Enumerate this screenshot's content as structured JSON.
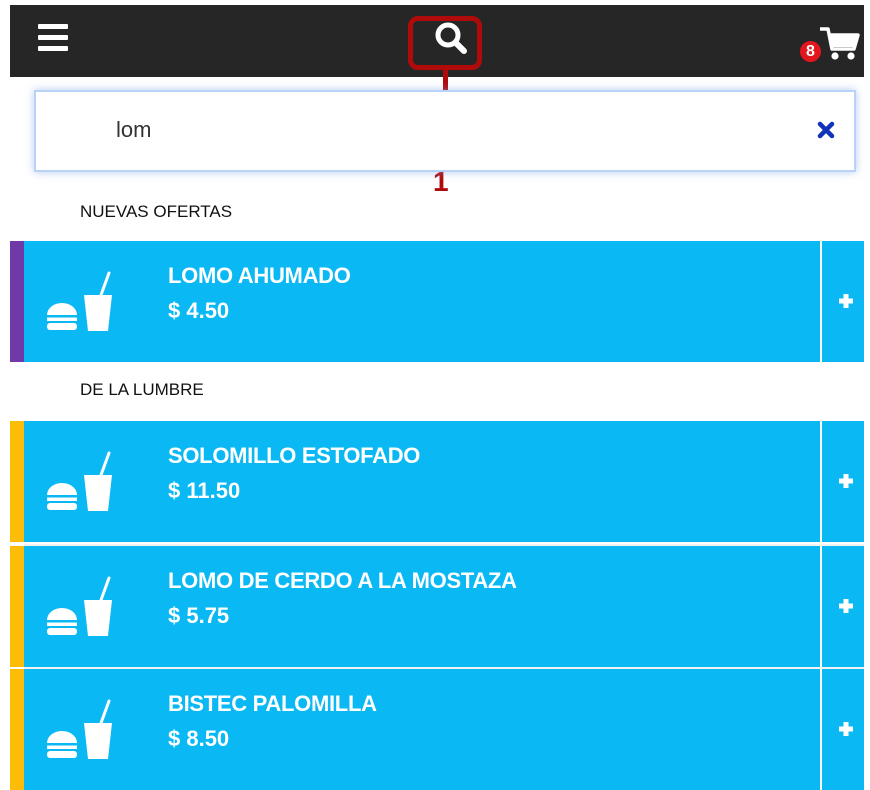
{
  "header": {
    "menu_icon": "hamburger-icon",
    "search_icon": "magnifier-icon",
    "cart_icon": "cart-icon",
    "cart_count": "8"
  },
  "annotation": {
    "callout_number": "1",
    "color": "#b00b0b"
  },
  "search": {
    "value": "lom",
    "clear_icon": "close-icon"
  },
  "sections": [
    {
      "label": "NUEVAS OFERTAS",
      "stripe_color": "#6f3aa8",
      "items": [
        {
          "name": "LOMO AHUMADO",
          "price": "$ 4.50"
        }
      ]
    },
    {
      "label": "DE LA LUMBRE",
      "stripe_color": "#fbbd08",
      "items": [
        {
          "name": "SOLOMILLO ESTOFADO",
          "price": "$ 11.50"
        },
        {
          "name": "LOMO DE CERDO A LA MOSTAZA",
          "price": "$ 5.75"
        },
        {
          "name": "BISTEC PALOMILLA",
          "price": "$ 8.50"
        }
      ]
    }
  ],
  "colors": {
    "item_bg": "#0ab8f4",
    "topbar_bg": "#262626",
    "badge": "#e3161d"
  },
  "item_icon": "burger-drink-icon",
  "add_icon": "plus-icon"
}
